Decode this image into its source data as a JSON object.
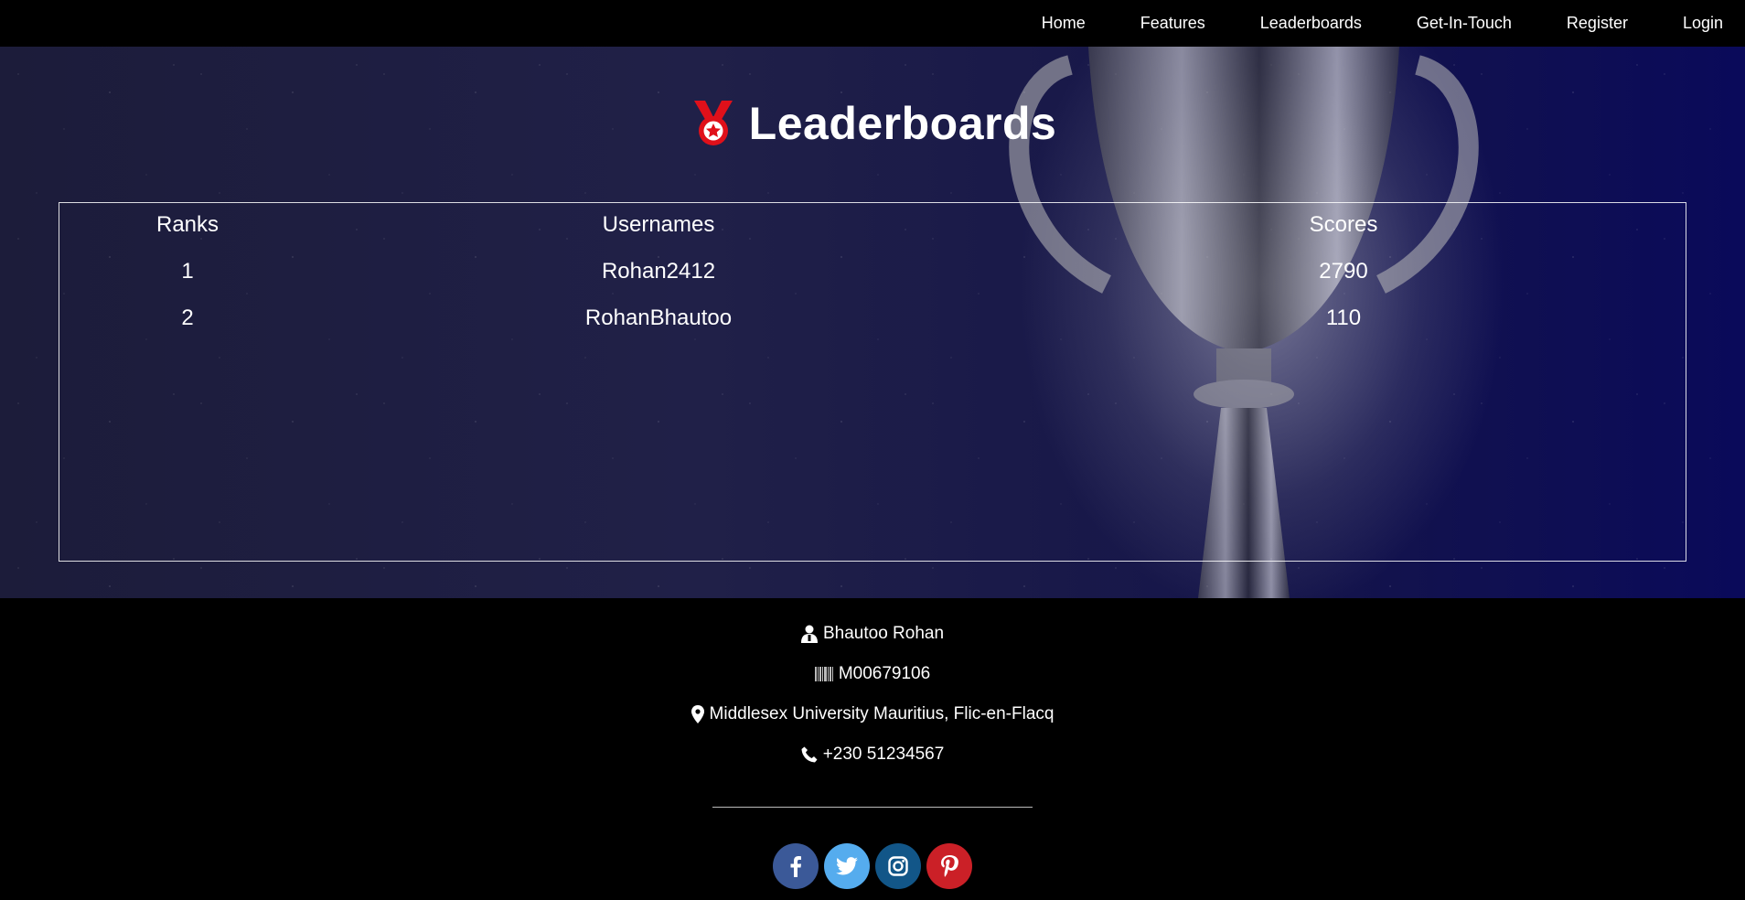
{
  "nav": {
    "items": [
      {
        "label": "Home"
      },
      {
        "label": "Features"
      },
      {
        "label": "Leaderboards"
      },
      {
        "label": "Get-In-Touch"
      },
      {
        "label": "Register"
      },
      {
        "label": "Login"
      }
    ]
  },
  "hero": {
    "title": "Leaderboards",
    "medal_icon": "medal-icon",
    "medal_color": "#e0101a"
  },
  "leaderboard": {
    "headers": {
      "rank": "Ranks",
      "username": "Usernames",
      "score": "Scores"
    },
    "rows": [
      {
        "rank": "1",
        "username": "Rohan2412",
        "score": "2790"
      },
      {
        "rank": "2",
        "username": "RohanBhautoo",
        "score": "110"
      }
    ]
  },
  "footer": {
    "name": "Bhautoo Rohan",
    "student_id": "M00679106",
    "address": "Middlesex University Mauritius, Flic-en-Flacq",
    "phone": "+230 51234567",
    "icons": {
      "name": "user-icon",
      "student_id": "barcode-icon",
      "address": "map-marker-icon",
      "phone": "phone-icon"
    },
    "socials": [
      {
        "name": "facebook-icon",
        "color": "#3b5998"
      },
      {
        "name": "twitter-icon",
        "color": "#55acee"
      },
      {
        "name": "instagram-icon",
        "color": "#125688"
      },
      {
        "name": "pinterest-icon",
        "color": "#cb2027"
      }
    ]
  }
}
